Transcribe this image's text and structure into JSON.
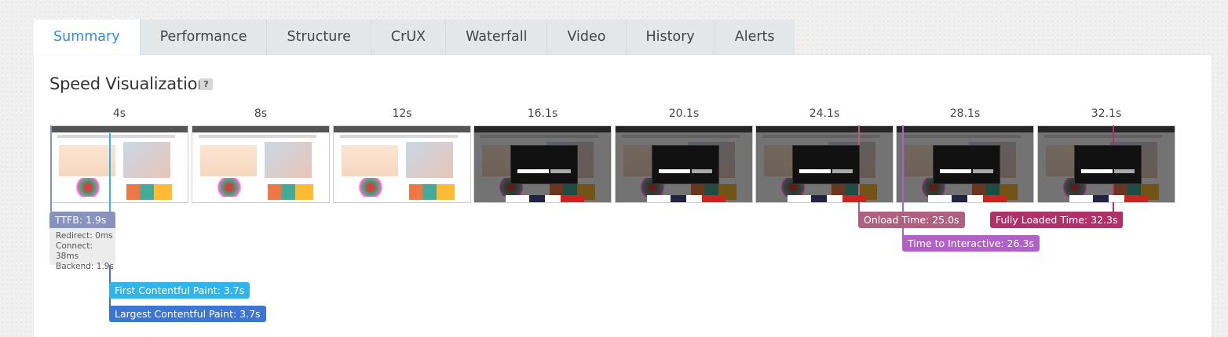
{
  "tabs": [
    {
      "label": "Summary",
      "active": true
    },
    {
      "label": "Performance",
      "active": false
    },
    {
      "label": "Structure",
      "active": false
    },
    {
      "label": "CrUX",
      "active": false
    },
    {
      "label": "Waterfall",
      "active": false
    },
    {
      "label": "Video",
      "active": false
    },
    {
      "label": "History",
      "active": false
    },
    {
      "label": "Alerts",
      "active": false
    }
  ],
  "section": {
    "title": "Speed Visualization",
    "help_label": "?"
  },
  "filmstrip": {
    "time_labels": [
      "4s",
      "8s",
      "12s",
      "16.1s",
      "20.1s",
      "24.1s",
      "28.1s",
      "32.1s"
    ],
    "frames_with_modal": [
      false,
      false,
      false,
      true,
      true,
      true,
      true,
      true
    ]
  },
  "ttfb": {
    "label": "TTFB: 1.9s",
    "redirect": "Redirect: 0ms",
    "connect": "Connect: 38ms",
    "backend": "Backend: 1.9s",
    "color": "#8892bf"
  },
  "markers": {
    "fcp": {
      "label": "First Contentful Paint: 3.7s",
      "color": "#2fb5ec"
    },
    "lcp": {
      "label": "Largest Contentful Paint: 3.7s",
      "color": "#3d75d6"
    },
    "onload": {
      "label": "Onload Time: 25.0s",
      "color": "#b0607f"
    },
    "tti": {
      "label": "Time to Interactive: 26.3s",
      "color": "#b160c8"
    },
    "fully_loaded": {
      "label": "Fully Loaded Time: 32.3s",
      "color": "#b0306a"
    }
  }
}
